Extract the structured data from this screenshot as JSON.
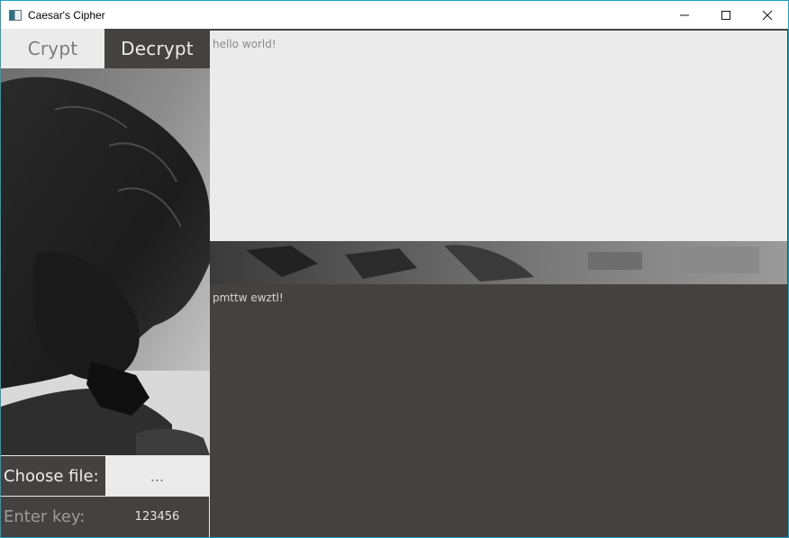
{
  "window": {
    "title": "Caesar's Cipher",
    "icons": {
      "app": "app-window-icon",
      "minimize": "minimize-icon",
      "maximize": "maximize-icon",
      "close": "close-icon"
    }
  },
  "tabs": {
    "crypt": "Crypt",
    "decrypt": "Decrypt"
  },
  "editor": {
    "input_text": "hello world!",
    "output_text": "pmttw ewztl!"
  },
  "controls": {
    "choose_file_label": "Choose file:",
    "choose_file_button": "...",
    "enter_key_label": "Enter key:",
    "key_value": "123456"
  },
  "colors": {
    "light_panel": "#ebebeb",
    "dark_panel": "#444241",
    "window_border": "#1aa0c8"
  }
}
